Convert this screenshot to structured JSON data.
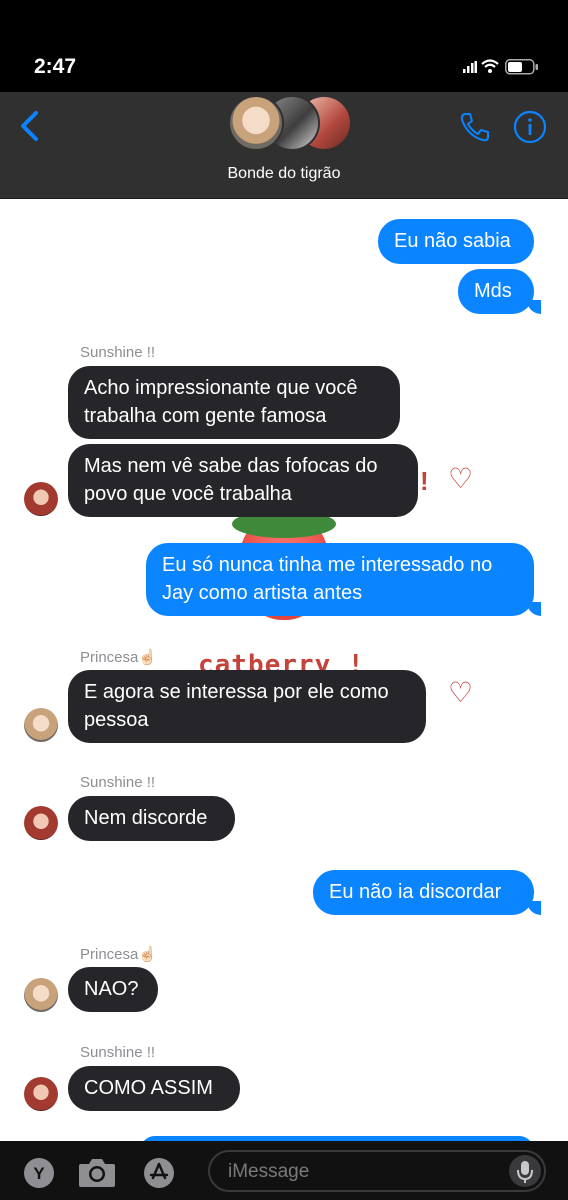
{
  "status": {
    "time": "2:47"
  },
  "header": {
    "title": "Bonde do tigrão"
  },
  "messages": [
    {
      "side": "out",
      "text": "Eu não sabia"
    },
    {
      "side": "out",
      "text": "Mds"
    },
    {
      "side": "in",
      "sender": "Sunshine !!",
      "text": "Acho impressionante que você trabalha com gente famosa"
    },
    {
      "side": "in",
      "text": "Mas nem vê sabe das fofocas do povo que você trabalha"
    },
    {
      "side": "out",
      "text": "Eu só nunca tinha me interessado no Jay como artista antes"
    },
    {
      "side": "in",
      "sender": "Princesa☝🏻",
      "text": "E agora se interessa por ele como pessoa"
    },
    {
      "side": "in",
      "sender": "Sunshine !!",
      "text": "Nem discorde"
    },
    {
      "side": "out",
      "text": "Eu não ia discordar"
    },
    {
      "side": "in",
      "sender": "Princesa☝🏻",
      "text": "NAO?"
    },
    {
      "side": "in",
      "sender": "Sunshine !!",
      "text": "COMO ASSIM"
    }
  ],
  "background_art": {
    "text": "catberry !",
    "heart": "♡",
    "exclaim": "!"
  },
  "input": {
    "placeholder": "iMessage"
  },
  "icons": {
    "back": "chevron-left-icon",
    "call": "phone-icon",
    "info": "info-icon",
    "apps": "app-store-icon",
    "camera": "camera-icon",
    "mic": "microphone-icon"
  },
  "colors": {
    "outgoing": "#0a84ff",
    "incoming": "#26252a",
    "header": "#303030"
  }
}
